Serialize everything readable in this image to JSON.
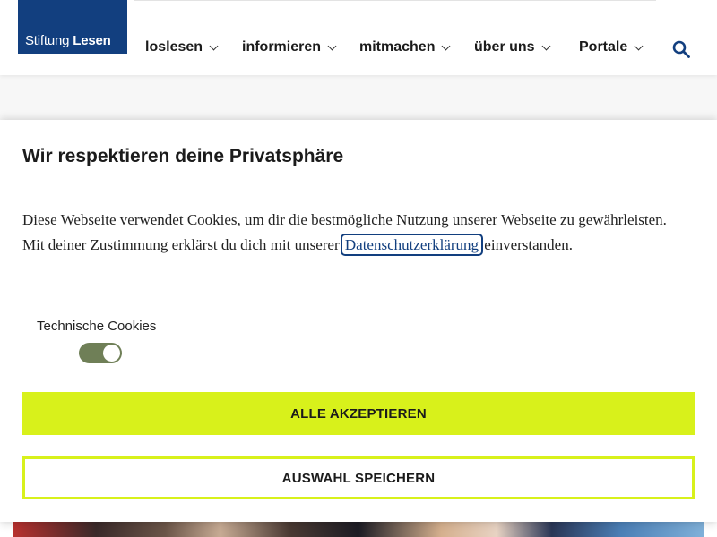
{
  "header": {
    "logo": {
      "light": "Stiftung",
      "bold": "Lesen"
    },
    "nav": [
      {
        "label": "loslesen"
      },
      {
        "label": "informieren"
      },
      {
        "label": "mitmachen"
      },
      {
        "label": "über uns"
      },
      {
        "label": "Portale"
      }
    ],
    "search_icon": "search-icon"
  },
  "cookie_dialog": {
    "title": "Wir respektieren deine Privatsphäre",
    "text_before": "Diese Webseite verwendet Cookies, um dir die bestmögliche Nutzung unserer Webseite zu gewährleisten. Mit deiner Zustimmung erklärst du dich mit unserer",
    "link": "Datenschutzerklärung",
    "text_after": "einverstanden.",
    "toggle": {
      "label": "Technische Cookies",
      "state": "on"
    },
    "buttons": {
      "accept_all": "ALLE AKZEPTIEREN",
      "save_selection": "AUSWAHL SPEICHERN"
    }
  },
  "colors": {
    "brand_blue": "#123f7f",
    "accent_lime": "#d8f11b",
    "toggle_on": "#6f7f57"
  }
}
